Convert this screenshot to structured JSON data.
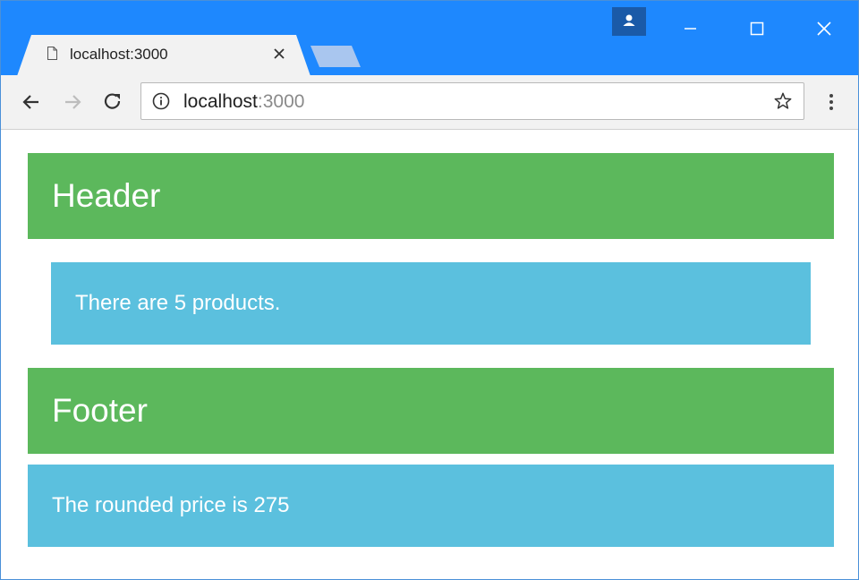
{
  "browser": {
    "tab": {
      "title": "localhost:3000",
      "page_icon": "page-icon",
      "close_icon": "close-icon"
    },
    "new_tab_icon": "new-tab-icon",
    "profile_icon": "person-icon",
    "window_controls": [
      "minimize-icon",
      "maximize-icon",
      "close-icon"
    ],
    "nav": [
      "back-arrow-icon",
      "forward-arrow-icon",
      "reload-icon"
    ],
    "address": {
      "host": "localhost",
      "port": ":3000",
      "info_icon": "info-icon",
      "star_icon": "star-icon"
    },
    "menu_icon": "kebab-menu-icon",
    "accent": "#1e88fe"
  },
  "page": {
    "header": "Header",
    "message": "There are 5 products.",
    "footer": "Footer",
    "price_text": "The rounded price is 275",
    "colors": {
      "green": "#5cb85c",
      "blue": "#5bc0de"
    }
  }
}
